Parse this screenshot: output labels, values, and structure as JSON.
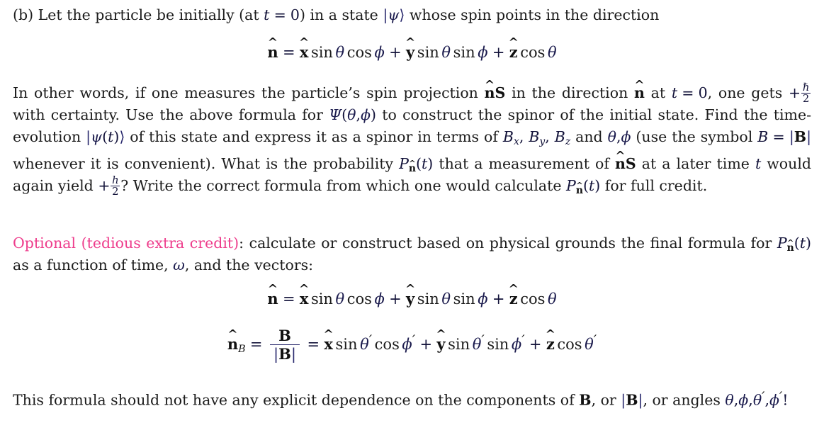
{
  "document": {
    "type": "physics-problem-set",
    "background_color": "#ffffff",
    "text_color": "#1c1c1c",
    "math_color": "#13133a",
    "accent_color": "#ee3d8c"
  },
  "problem_b": {
    "label": "(b)",
    "line": {
      "t1": "Let the particle be initially (at ",
      "var_t": "t",
      "eq": "=",
      "zero": "0",
      "t2": ") in a state ",
      "ket_open": "|",
      "psi": "ψ",
      "ket_close": "⟩",
      "t3": " whose spin points in the direction"
    }
  },
  "equation_n": {
    "name": "n-hat-direction",
    "lhs_vector": "n",
    "equals": "=",
    "term1": {
      "vector": "x",
      "op1": "sin",
      "angle1": "θ",
      "op2": "cos",
      "angle2": "ϕ"
    },
    "plus1": "+",
    "term2": {
      "vector": "y",
      "op1": "sin",
      "angle1": "θ",
      "op2": "sin",
      "angle2": "ϕ"
    },
    "plus2": "+",
    "term3": {
      "vector": "z",
      "op1": "cos",
      "angle1": "θ"
    }
  },
  "main_paragraph": {
    "s1": "In other words, if one measures the particle’s spin projection ",
    "nS_n": "n",
    "nS_S": "S",
    "s2": " in the direction ",
    "n2": "n",
    "s3": " at ",
    "t_var": "t",
    "eq1": "=",
    "zero": "0",
    "s4": ", one gets",
    "s5": "+",
    "hbar_num": "ℏ",
    "hbar_den": "2",
    "s6": " with certainty. Use the above formula for ",
    "Psi": "Ψ",
    "Psi_open": "(",
    "Psi_theta": "θ",
    "Psi_comma": ",",
    "Psi_phi": "ϕ",
    "Psi_close": ")",
    "s7": " to construct the spinor of the initial state. Find",
    "s8": "the time-evolution ",
    "psi_ket_open": "|",
    "psi_sym": "ψ",
    "psi_t_open": "(",
    "psi_t": "t",
    "psi_t_close": ")",
    "psi_ket_close": "⟩",
    "s9": " of this state and express it as a spinor in terms of ",
    "Bx": "B",
    "Bx_sub": "x",
    "By": "B",
    "By_sub": "y",
    "Bz": "B",
    "Bz_sub": "z",
    "s10": " and ",
    "theta": "θ",
    "comma": ",",
    "phi": "ϕ",
    "s11": " (use",
    "s12": "the symbol ",
    "B_sym": "B",
    "eq2": "=",
    "absB_open": "|",
    "absB": "B",
    "absB_close": "|",
    "s13": " whenever it is convenient). What is the probability ",
    "P_sym": "P",
    "P_sub": "n",
    "P_open": "(",
    "P_t": "t",
    "P_close": ")",
    "s14": " that a measurement of",
    "s15_n": "n",
    "s15_S": "S",
    "s16": " at a later time ",
    "t2_var": "t",
    "s17": " would again yield ",
    "s18": "+",
    "h_num": "h",
    "h_den": "2",
    "s19": "? Write the correct formula from which one would calculate",
    "s20_P": "P",
    "s20_sub": "n",
    "s20_open": "(",
    "s20_t": "t",
    "s20_close": ")",
    "s21": " for full credit."
  },
  "optional_paragraph": {
    "label": "Optional (tedious extra credit)",
    "colon": ":",
    "s1": " calculate or construct based on physical grounds the final formula for",
    "P_sym": "P",
    "P_sub": "n",
    "P_open": "(",
    "P_t": "t",
    "P_close": ")",
    "s2": " as a function of time, ",
    "omega": "ω",
    "s3": ", and the vectors:"
  },
  "equation_nB": {
    "name": "n-hat-B-unit-vector",
    "lhs_vector": "n",
    "lhs_sub": "B",
    "equals1": "=",
    "frac_num": "B",
    "frac_den_open": "|",
    "frac_den_B": "B",
    "frac_den_close": "|",
    "equals2": "=",
    "term1": {
      "vector": "x",
      "op1": "sin",
      "angle1": "θ",
      "prime1": "′",
      "op2": "cos",
      "angle2": "ϕ",
      "prime2": "′"
    },
    "plus1": "+",
    "term2": {
      "vector": "y",
      "op1": "sin",
      "angle1": "θ",
      "prime1": "′",
      "op2": "sin",
      "angle2": "ϕ",
      "prime2": "′"
    },
    "plus2": "+",
    "term3": {
      "vector": "z",
      "op1": "cos",
      "angle1": "θ",
      "prime1": "′"
    }
  },
  "final_paragraph": {
    "s1": "This formula should not have any explicit dependence on the components of ",
    "B1": "B",
    "s2": ", or ",
    "absB_open": "|",
    "absB": "B",
    "absB_close": "|",
    "s3": ", or angles",
    "theta": "θ",
    "c1": ",",
    "phi": "ϕ",
    "c2": ",",
    "theta_p": "θ",
    "prime1": "′",
    "c3": ",",
    "phi_p": "ϕ",
    "prime2": "′",
    "bang": "!"
  }
}
